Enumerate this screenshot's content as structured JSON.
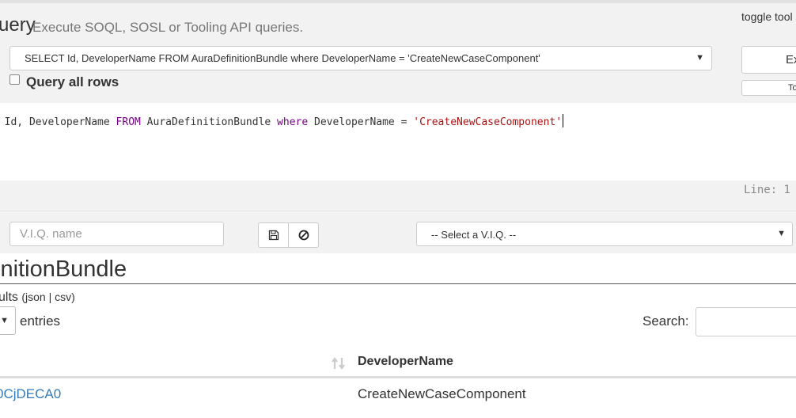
{
  "header": {
    "title": "uery",
    "subtitle": "Execute SOQL, SOSL or Tooling API queries.",
    "toggle_tools": "toggle tool"
  },
  "query": {
    "selected": "SELECT Id, DeveloperName FROM AuraDefinitionBundle where DeveloperName = 'CreateNewCaseComponent'",
    "execute_label": "Ex",
    "secondary_button_label": "To",
    "query_all_rows_label": "Query all rows",
    "query_all_rows_checked": false
  },
  "editor": {
    "tokens": [
      {
        "text": "' Id, DeveloperName ",
        "type": "plain"
      },
      {
        "text": "FROM",
        "type": "keyword"
      },
      {
        "text": " AuraDefinitionBundle ",
        "type": "plain"
      },
      {
        "text": "where",
        "type": "keyword"
      },
      {
        "text": " DeveloperName = ",
        "type": "plain"
      },
      {
        "text": "'CreateNewCaseComponent'",
        "type": "string"
      }
    ],
    "line_indicator": "Line: 1"
  },
  "viq": {
    "name_placeholder": "V.I.Q. name",
    "select_placeholder": "-- Select a V.I.Q. --"
  },
  "results": {
    "title": "finitionBundle",
    "results_prefix": "ults ",
    "format_open": "(",
    "format_json": "json",
    "format_sep": " | ",
    "format_csv": "csv",
    "format_close": ")",
    "entries_label": "entries",
    "search_label": "Search:",
    "columns": [
      "",
      "DeveloperName"
    ],
    "rows": [
      {
        "id": "0CjDECA0",
        "developer_name": "CreateNewCaseComponent"
      }
    ]
  },
  "icons": {
    "save": "save-icon",
    "clear": "ban-icon",
    "sort": "sort-icon",
    "dropdown": "chevron-down-icon"
  },
  "colors": {
    "link": "#337ab7",
    "keyword": "#770088",
    "string": "#aa1111",
    "panel": "#f2f2f2"
  }
}
